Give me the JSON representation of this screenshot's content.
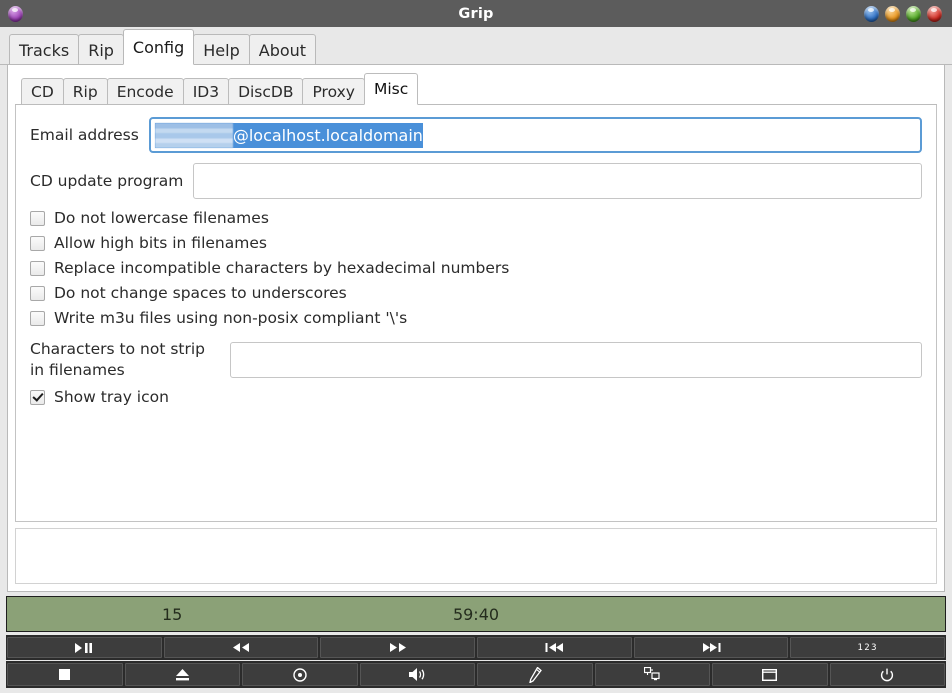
{
  "window": {
    "title": "Grip",
    "app_icon": "app-orb-icon",
    "buttons": [
      {
        "name": "shade-button",
        "icon": "orb-blue-icon",
        "color": "#2d6fc4"
      },
      {
        "name": "minimize-button",
        "icon": "orb-orange-icon",
        "color": "#e8941c"
      },
      {
        "name": "maximize-button",
        "icon": "orb-green-icon",
        "color": "#4fa524"
      },
      {
        "name": "close-button",
        "icon": "orb-red-icon",
        "color": "#cf2a20"
      }
    ]
  },
  "main_tabs": {
    "active": "Config",
    "items": [
      {
        "label": "Tracks"
      },
      {
        "label": "Rip"
      },
      {
        "label": "Config"
      },
      {
        "label": "Help"
      },
      {
        "label": "About"
      }
    ]
  },
  "config_tabs": {
    "active": "Misc",
    "items": [
      {
        "label": "CD"
      },
      {
        "label": "Rip"
      },
      {
        "label": "Encode"
      },
      {
        "label": "ID3"
      },
      {
        "label": "DiscDB"
      },
      {
        "label": "Proxy"
      },
      {
        "label": "Misc"
      }
    ]
  },
  "misc_panel": {
    "email": {
      "label": "Email address",
      "value": "@localhost.localdomain",
      "redacted_prefix": true,
      "selected": true,
      "focused": true,
      "placeholder": ""
    },
    "cd_update": {
      "label": "CD update program",
      "value": "",
      "placeholder": ""
    },
    "checkboxes": [
      {
        "label": "Do not lowercase filenames",
        "checked": false
      },
      {
        "label": "Allow high bits in filenames",
        "checked": false
      },
      {
        "label": "Replace incompatible characters by hexadecimal numbers",
        "checked": false
      },
      {
        "label": "Do not change spaces to underscores",
        "checked": false
      },
      {
        "label": "Write m3u files using non-posix compliant '\\'s",
        "checked": false
      }
    ],
    "chars_to_not_strip": {
      "label_line1": "Characters to not strip",
      "label_line2": "in filenames",
      "value": "",
      "placeholder": ""
    },
    "tray": {
      "label": "Show tray icon",
      "checked": true
    }
  },
  "status": {
    "track": "15",
    "time": "59:40",
    "background": "#8ba177"
  },
  "transport_row1": [
    {
      "name": "play-pause-button",
      "icon": "play-pause-icon"
    },
    {
      "name": "rewind-button",
      "icon": "rewind-icon"
    },
    {
      "name": "fast-forward-button",
      "icon": "fast-forward-icon"
    },
    {
      "name": "previous-track-button",
      "icon": "previous-track-icon"
    },
    {
      "name": "next-track-button",
      "icon": "next-track-icon"
    },
    {
      "name": "track-number-button",
      "icon": "track-number-icon",
      "text": "123"
    }
  ],
  "transport_row2": [
    {
      "name": "stop-button",
      "icon": "stop-icon"
    },
    {
      "name": "eject-button",
      "icon": "eject-icon"
    },
    {
      "name": "disc-button",
      "icon": "disc-icon"
    },
    {
      "name": "volume-button",
      "icon": "volume-icon"
    },
    {
      "name": "edit-button",
      "icon": "pencil-icon"
    },
    {
      "name": "discdb-button",
      "icon": "network-scan-icon"
    },
    {
      "name": "minimize-view-button",
      "icon": "window-icon"
    },
    {
      "name": "power-button",
      "icon": "power-icon"
    }
  ]
}
